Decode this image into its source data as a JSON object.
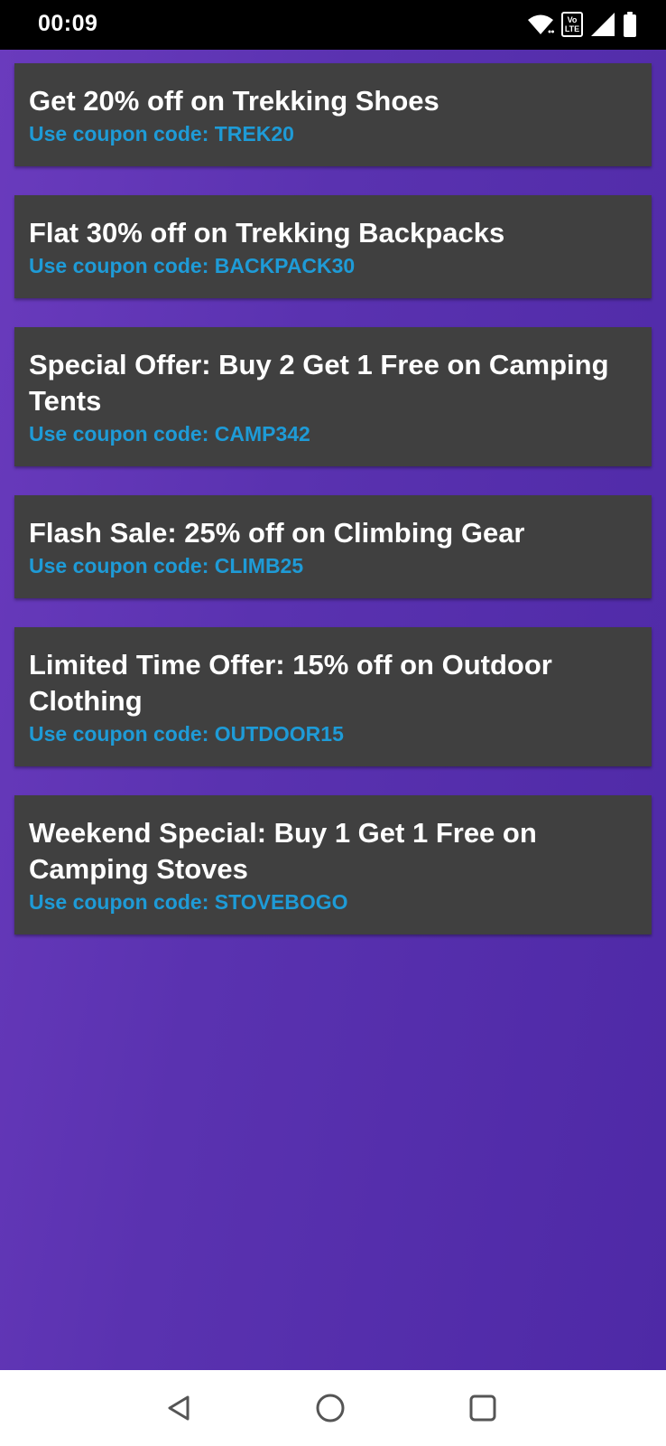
{
  "status_bar": {
    "time": "00:09",
    "volte_top": "Vo",
    "volte_bottom": "LTE",
    "icons": [
      "wifi-icon",
      "volte-icon",
      "signal-icon",
      "battery-icon"
    ]
  },
  "colors": {
    "background_start": "#6a3bbd",
    "background_end": "#4e29a6",
    "card_background": "#404040",
    "title_text": "#ffffff",
    "coupon_text": "#1e9bd7"
  },
  "offers": [
    {
      "title": "Get 20% off on Trekking Shoes",
      "coupon": "Use coupon code: TREK20"
    },
    {
      "title": "Flat 30% off on Trekking Backpacks",
      "coupon": "Use coupon code: BACKPACK30"
    },
    {
      "title": "Special Offer: Buy 2 Get 1 Free on Camping Tents",
      "coupon": "Use coupon code: CAMP342"
    },
    {
      "title": "Flash Sale: 25% off on Climbing Gear",
      "coupon": "Use coupon code: CLIMB25"
    },
    {
      "title": "Limited Time Offer: 15% off on Outdoor Clothing",
      "coupon": "Use coupon code: OUTDOOR15"
    },
    {
      "title": "Weekend Special: Buy 1 Get 1 Free on Camping Stoves",
      "coupon": "Use coupon code: STOVEBOGO"
    }
  ],
  "nav_bar": {
    "buttons": [
      "back-icon",
      "home-icon",
      "recents-icon"
    ]
  }
}
